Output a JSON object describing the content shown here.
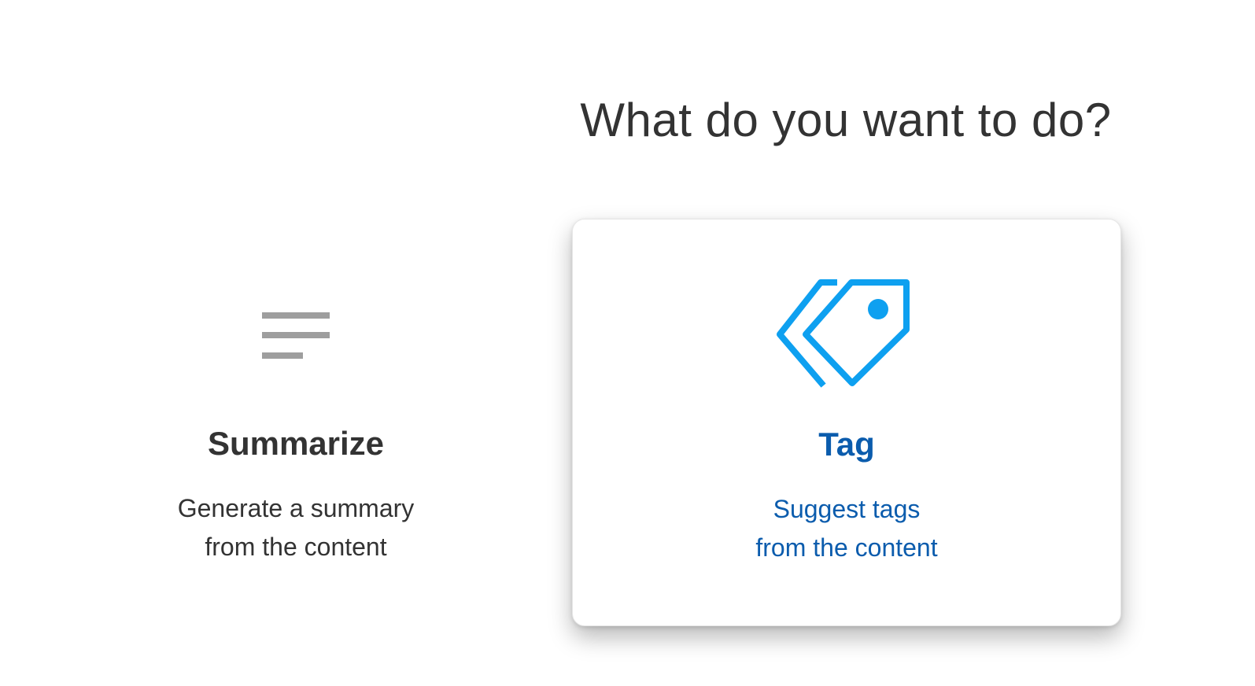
{
  "heading": "What do you want to do?",
  "colors": {
    "text": "#333333",
    "selected_text": "#0b5cad",
    "selected_icon": "#0ea0f0",
    "muted_icon": "#9e9e9e"
  },
  "options": [
    {
      "id": "summarize",
      "icon": "lines-icon",
      "title": "Summarize",
      "description_lines": [
        "Generate a summary",
        "from the content"
      ],
      "selected": false
    },
    {
      "id": "tag",
      "icon": "tags-icon",
      "title": "Tag",
      "description_lines": [
        "Suggest tags",
        "from the content"
      ],
      "selected": true
    }
  ]
}
